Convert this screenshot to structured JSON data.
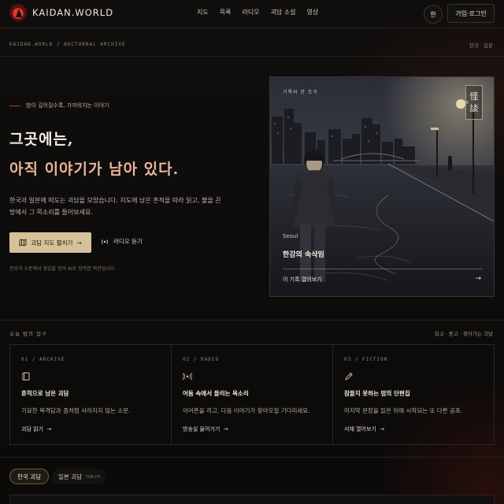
{
  "header": {
    "logo_text": "KAIDAN.WORLD",
    "nav": [
      "지도",
      "목록",
      "라디오",
      "괴담 소설",
      "영상"
    ],
    "lang_button": "한",
    "login_button": "가입·로그인"
  },
  "breadcrumb": {
    "path": "KAIDAN.WORLD / NOCTURNAL ARCHIVE",
    "lang_switch": "한국 · 일본"
  },
  "hero": {
    "eyebrow": "밤이 깊어질수록, 가까워지는 이야기",
    "headline_line1": "그곳에는,",
    "headline_line2": "아직 이야기가 남아 있다.",
    "description": "한국과 일본에 떠도는 괴담을 모았습니다. 지도에 남은 흔적을 따라 읽고, 불을 끈 방에서 그 목소리를 들어보세요.",
    "primary_button": "괴담 지도 펼치기",
    "radio_link": "라디오 듣기",
    "footnote": "전승과 소문에서 영감을 얻어 AI로 창작한 픽션입니다."
  },
  "feature_card": {
    "tag": "기록의 한 조각",
    "kanji": [
      "怪",
      "談"
    ],
    "place": "Seoul",
    "title": "한강의 속삭임",
    "link": "이 기록 열어보기"
  },
  "section": {
    "label": "오늘 밤의 입구",
    "right": "읽고 · 듣고 · 찾아가는 괴담",
    "cards": [
      {
        "num": "01 / ARCHIVE",
        "icon": "book-icon",
        "title": "흔적으로 남은 괴담",
        "desc": "기묘한 목격담과 좀처럼 사라지지 않는 소문.",
        "link": "괴담 읽기"
      },
      {
        "num": "02 / RADIO",
        "icon": "radio-icon",
        "title": "어둠 속에서 들리는 목소리",
        "desc": "이어폰을 끼고, 다음 이야기가 찾아오길 기다리세요.",
        "link": "방송실 들어가기"
      },
      {
        "num": "03 / FICTION",
        "icon": "pen-icon",
        "title": "잠들지 못하는 밤의 단편집",
        "desc": "마지막 문장을 읽은 뒤에 시작되는 또 다른 공포.",
        "link": "서재 열어보기"
      }
    ]
  },
  "tabs": {
    "active": "한국 괴담",
    "other": "일본 괴담",
    "other_sub": "이포니아"
  },
  "colors": {
    "accent": "#d6c29a",
    "headline_accent": "#e9b49a",
    "brand_red": "#e23a2b",
    "background": "#0d0b0a"
  }
}
